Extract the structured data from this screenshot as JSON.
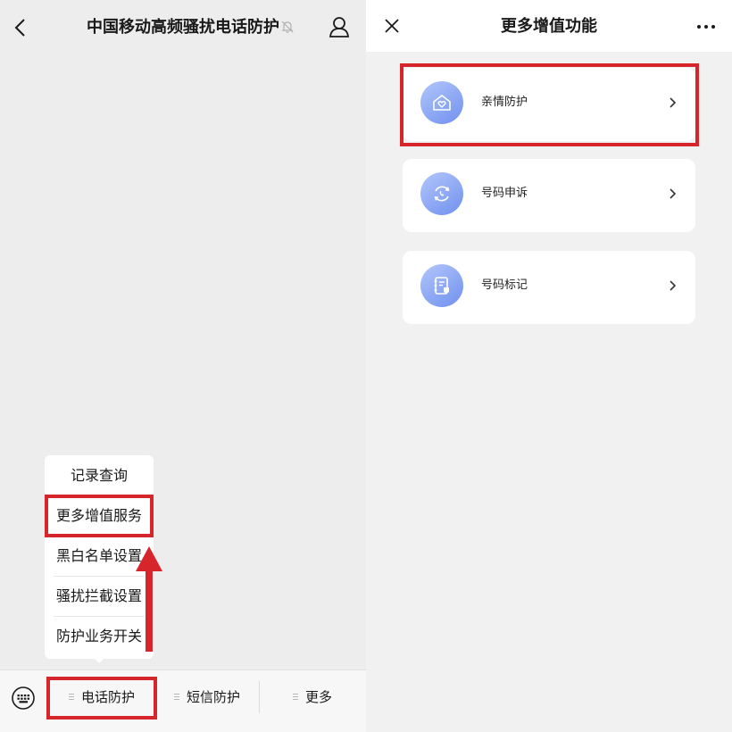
{
  "left_panel": {
    "title": "中国移动高频骚扰电话防护",
    "icons": {
      "back": "chevron-left-icon",
      "mute": "bell-muted-icon",
      "profile": "user-icon",
      "keyboard": "keyboard-icon"
    },
    "popup_menu": {
      "items": [
        "记录查询",
        "更多增值服务",
        "黑白名单设置",
        "骚扰拦截设置",
        "防护业务开关"
      ],
      "highlighted_item": "更多增值服务"
    },
    "bottom_tabs": [
      "电话防护",
      "短信防护",
      "更多"
    ],
    "highlighted_tab": "电话防护"
  },
  "right_panel": {
    "title": "更多增值功能",
    "icons": {
      "close": "close-icon",
      "more": "more-dots-icon"
    },
    "items": [
      {
        "label": "亲情防护",
        "icon": "house-heart-icon"
      },
      {
        "label": "号码申诉",
        "icon": "phone-refresh-icon"
      },
      {
        "label": "号码标记",
        "icon": "notebook-tag-icon"
      }
    ],
    "highlighted_item": "亲情防护"
  },
  "colors": {
    "highlight_red": "#d6262b",
    "icon_gradient_start": "#b3c6fb",
    "icon_gradient_end": "#6f90ee",
    "left_background": "#ededed",
    "right_background": "#f1f1f1"
  }
}
